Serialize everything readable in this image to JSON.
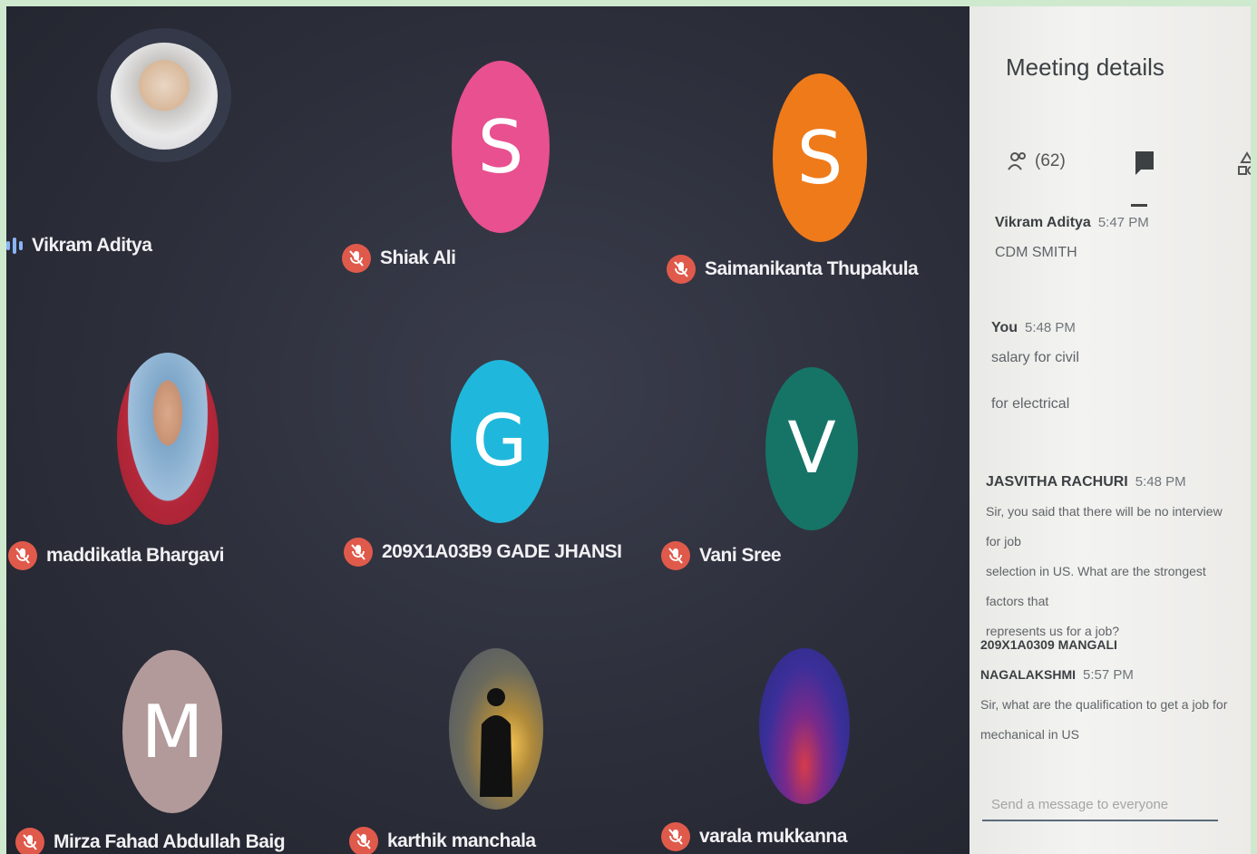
{
  "participants": [
    {
      "name": "Vikram Aditya",
      "initial": "",
      "color": "",
      "photo": true,
      "speaking": true
    },
    {
      "name": "Shiak Ali",
      "initial": "S",
      "color": "#e8508f",
      "muted": true
    },
    {
      "name": "Saimanikanta Thupakula",
      "initial": "S",
      "color": "#ef7a1a",
      "muted": true
    },
    {
      "name": "maddikatla Bhargavi",
      "initial": "",
      "color": "",
      "photo": true,
      "muted": true
    },
    {
      "name": "209X1A03B9 GADE JHANSI",
      "initial": "G",
      "color": "#1fb8dc",
      "muted": true
    },
    {
      "name": "Vani Sree",
      "initial": "V",
      "color": "#167467",
      "muted": true
    },
    {
      "name": "Mirza Fahad Abdullah Baig",
      "initial": "M",
      "color": "#b29a9a",
      "muted": true
    },
    {
      "name": "karthik manchala",
      "initial": "",
      "color": "",
      "photo": true,
      "muted": true
    },
    {
      "name": "varala mukkanna",
      "initial": "",
      "color": "",
      "photo": true,
      "muted": true
    }
  ],
  "panel": {
    "title": "Meeting details",
    "people_count": "(62)",
    "tabs": [
      "people-icon",
      "chat-icon",
      "activities-icon"
    ],
    "messages": [
      {
        "sender": "Vikram Aditya",
        "time": "5:47 PM",
        "lines": [
          "CDM SMITH"
        ]
      },
      {
        "sender": "You",
        "time": "5:48 PM",
        "lines": [
          "salary for civil",
          "",
          "for electrical"
        ]
      },
      {
        "sender": "JASVITHA RACHURI",
        "time": "5:48 PM",
        "lines": [
          "Sir, you said that there will be no interview for job",
          "selection in US. What are the strongest factors that",
          "represents us for a job?"
        ]
      },
      {
        "sender": "209X1A0309 MANGALI NAGALAKSHMI",
        "time": "5:57 PM",
        "lines": [
          "Sir, what are the qualification to get a job for",
          "mechanical in US"
        ]
      }
    ],
    "compose_placeholder": "Send a message to everyone"
  }
}
